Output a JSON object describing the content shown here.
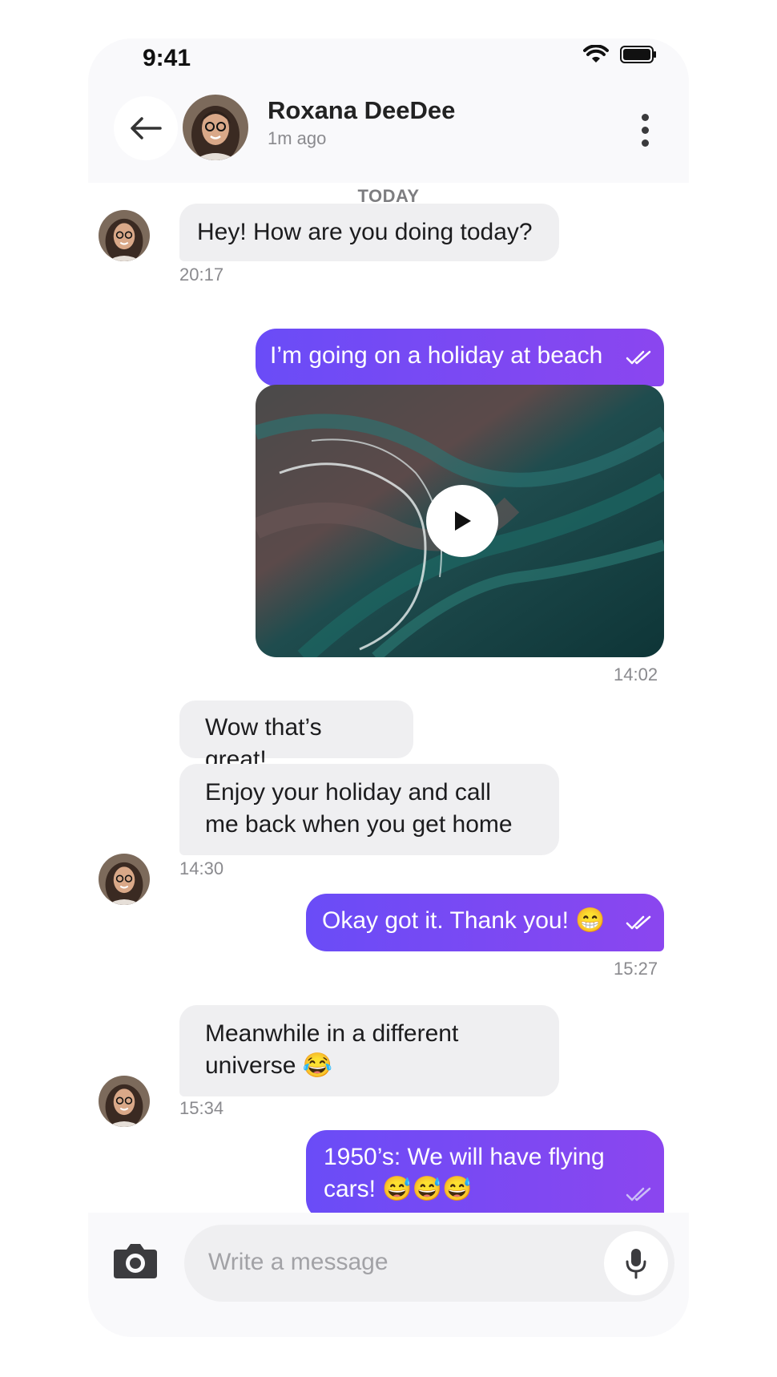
{
  "status_bar": {
    "time": "9:41"
  },
  "header": {
    "name": "Roxana DeeDee",
    "last_seen": "1m ago"
  },
  "day_label": "TODAY",
  "messages": [
    {
      "text": "Hey! How are you doing today?",
      "time": "20:17"
    },
    {
      "text": "I’m going on a holiday at beach"
    },
    {
      "time": "14:02"
    },
    {
      "text": "Wow that’s great!"
    },
    {
      "line1": "Enjoy your holiday and call",
      "line2": "me back when you get home",
      "time": "14:30"
    },
    {
      "text": "Okay got it. Thank you!",
      "emoji": "😁",
      "time": "15:27"
    },
    {
      "line1": "Meanwhile in a different",
      "line2": "universe",
      "emoji": "😂",
      "time": "15:34"
    },
    {
      "line1": "1950’s: We will have flying",
      "line2": "cars!",
      "emoji": "😅😅😅"
    }
  ],
  "composer": {
    "placeholder": "Write a message"
  },
  "colors": {
    "outgoing_start": "#6a4cf7",
    "outgoing_end": "#8b46ef",
    "incoming": "#efeff1"
  },
  "icons": [
    "back-arrow-icon",
    "more-vertical-icon",
    "double-check-icon",
    "play-icon",
    "camera-icon",
    "microphone-icon",
    "wifi-icon",
    "battery-icon"
  ]
}
